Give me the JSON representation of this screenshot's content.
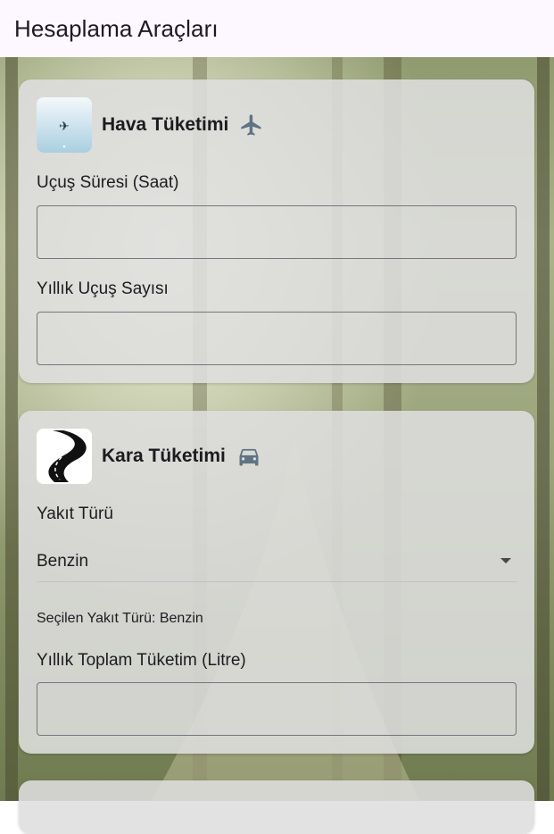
{
  "appbar": {
    "title": "Hesaplama Araçları"
  },
  "air_card": {
    "title": "Hava Tüketimi",
    "icon": "airplane-icon",
    "fields": [
      {
        "label": "Uçuş Süresi (Saat)",
        "value": ""
      },
      {
        "label": "Yıllık Uçuş Sayısı",
        "value": ""
      }
    ]
  },
  "land_card": {
    "title": "Kara Tüketimi",
    "icon": "car-icon",
    "fuel_label": "Yakıt Türü",
    "fuel_selected": "Benzin",
    "selected_note": "Seçilen Yakıt Türü: Benzin",
    "consumption_label": "Yıllık Toplam Tüketim (Litre)",
    "consumption_value": ""
  },
  "colors": {
    "appbar_bg": "#fdf7ff",
    "card_bg": "#dedede",
    "icon_color": "#5f7383",
    "field_border": "#79747e"
  }
}
